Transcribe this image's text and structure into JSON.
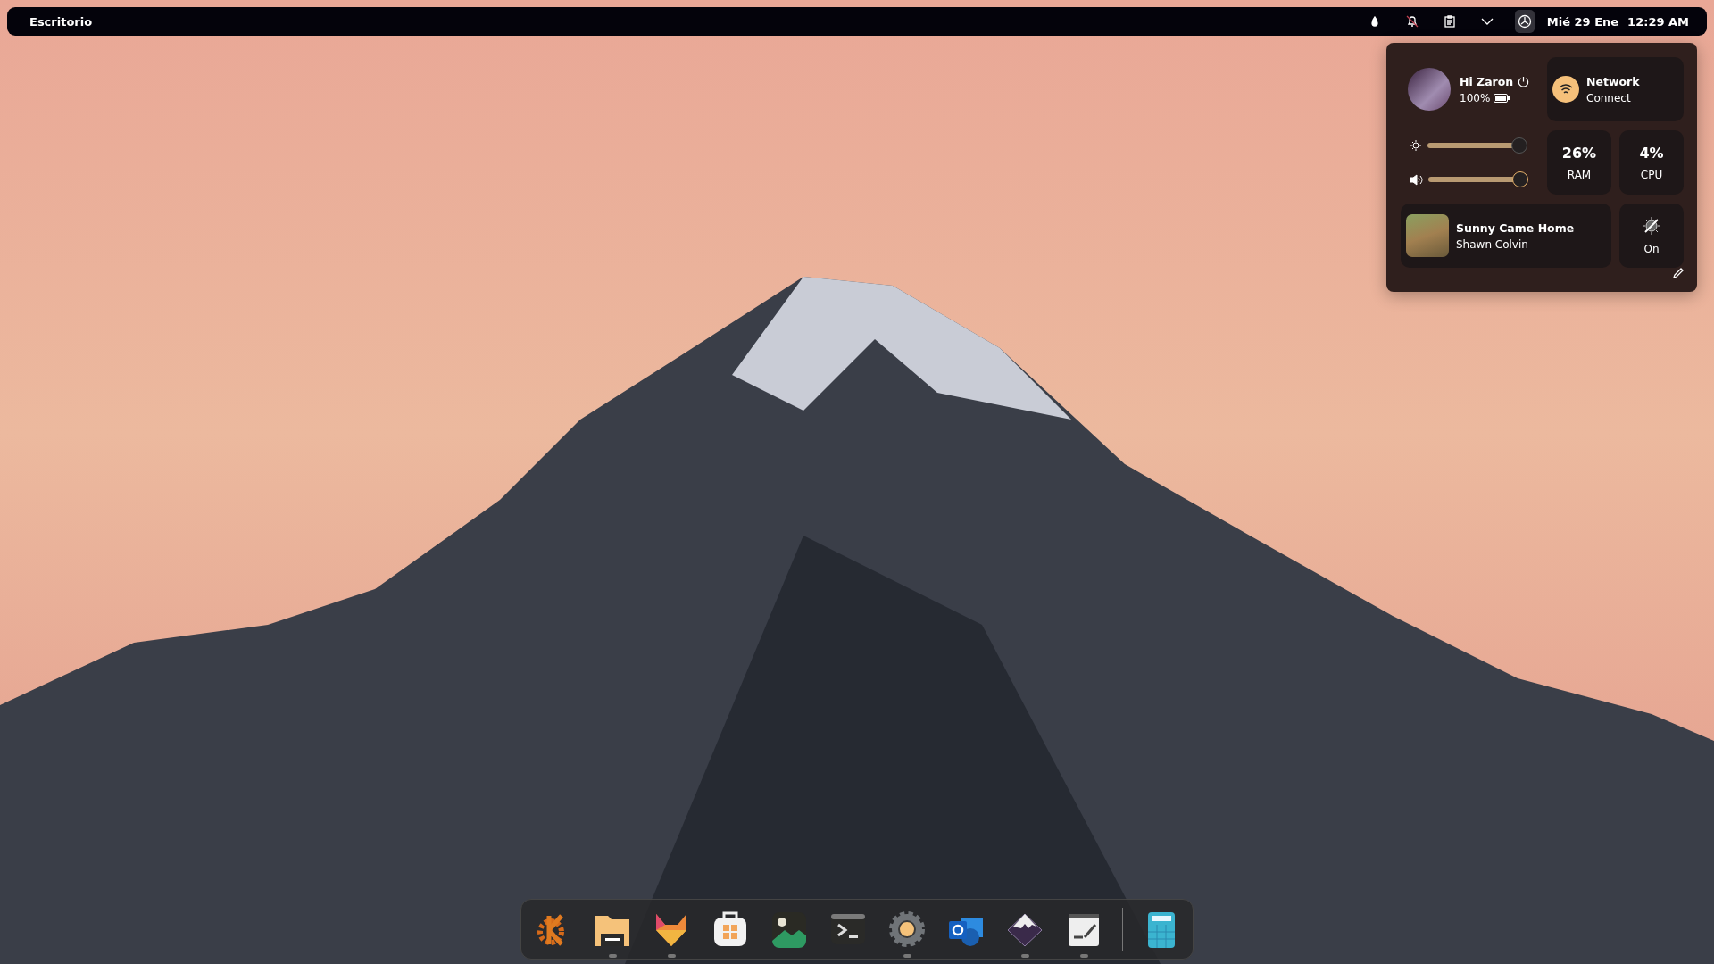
{
  "top_bar": {
    "title": "Escritorio",
    "tray": [
      {
        "kind": "drop",
        "selected": false
      },
      {
        "kind": "bell-off",
        "selected": false
      },
      {
        "kind": "clipboard",
        "selected": false
      },
      {
        "kind": "chevron",
        "selected": false
      },
      {
        "kind": "settings",
        "selected": true
      }
    ],
    "date": "Mié 29 Ene",
    "time": "12:29 AM"
  },
  "panel": {
    "greeting": "Hi Zaron",
    "battery": "100%",
    "network": {
      "title": "Network",
      "status": "Connect"
    },
    "sliders": [
      {
        "kind": "brightness",
        "level": 0.93
      },
      {
        "kind": "volume",
        "level": 0.93
      }
    ],
    "stats": [
      {
        "value": "26%",
        "label": "RAM"
      },
      {
        "value": "4%",
        "label": "CPU"
      }
    ],
    "media": {
      "title": "Sunny Came Home",
      "artist": "Shawn Colvin"
    },
    "night_light": {
      "label": "On"
    }
  },
  "dock": [
    {
      "kind": "kde",
      "running": false
    },
    {
      "kind": "folder",
      "running": true
    },
    {
      "kind": "fox",
      "running": true
    },
    {
      "kind": "store",
      "running": false
    },
    {
      "kind": "image",
      "running": false
    },
    {
      "kind": "terminal",
      "running": false
    },
    {
      "kind": "gear",
      "running": true
    },
    {
      "kind": "mail",
      "running": false
    },
    {
      "kind": "mountain",
      "running": true
    },
    {
      "kind": "notes",
      "running": true
    },
    {
      "kind": "separator"
    },
    {
      "kind": "calculator",
      "running": false
    }
  ]
}
